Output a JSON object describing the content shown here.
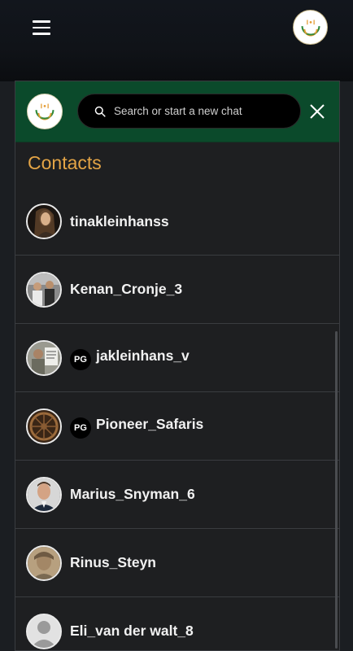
{
  "header": {
    "menu_icon": "hamburger-menu-icon",
    "logo_icon": "app-logo-icon"
  },
  "panel": {
    "search": {
      "placeholder": "Search or start a new chat",
      "icon": "search-icon"
    },
    "close_icon": "close-icon",
    "section_title": "Contacts"
  },
  "contacts": [
    {
      "name": "tinakleinhanss",
      "badge": "",
      "avatar": "tina-avatar"
    },
    {
      "name": "Kenan_Cronje_3",
      "badge": "",
      "avatar": "kenan-avatar"
    },
    {
      "name": "jakleinhans_v",
      "badge": "PG",
      "avatar": "jak-avatar"
    },
    {
      "name": "Pioneer_Safaris",
      "badge": "PG",
      "avatar": "wheel-avatar"
    },
    {
      "name": "Marius_Snyman_6",
      "badge": "",
      "avatar": "marius-avatar"
    },
    {
      "name": "Rinus_Steyn",
      "badge": "",
      "avatar": "rinus-avatar"
    },
    {
      "name": "Eli_van der walt_8",
      "badge": "",
      "avatar": "default-avatar"
    }
  ],
  "colors": {
    "header_green": "#0b4a2b",
    "section_title": "#e3a446",
    "panel_bg": "#1e1f21"
  }
}
